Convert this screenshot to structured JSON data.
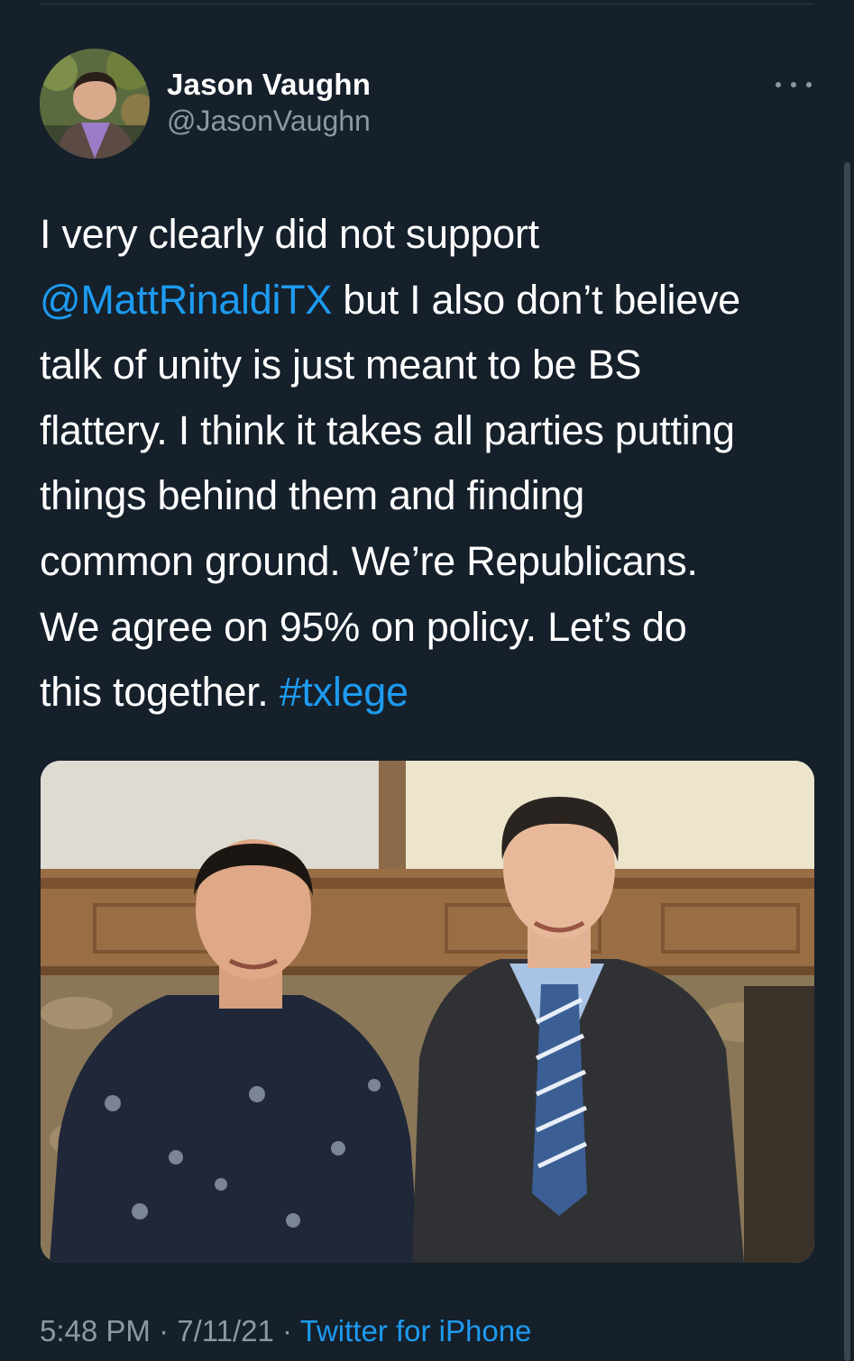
{
  "author": {
    "display_name": "Jason Vaughn",
    "handle": "@JasonVaughn"
  },
  "tweet": {
    "lines": [
      [
        {
          "text": "I very clearly did not support",
          "type": "text"
        }
      ],
      [
        {
          "text": "@MattRinaldiTX",
          "type": "mention"
        },
        {
          "text": " but I also don’t believe",
          "type": "text"
        }
      ],
      [
        {
          "text": "talk of unity is just meant to be BS",
          "type": "text"
        }
      ],
      [
        {
          "text": "flattery. I think it takes all parties putting",
          "type": "text"
        }
      ],
      [
        {
          "text": "things behind them and finding",
          "type": "text"
        }
      ],
      [
        {
          "text": "common ground. We’re Republicans.",
          "type": "text"
        }
      ],
      [
        {
          "text": "We agree on 95% on policy. Let’s do",
          "type": "text"
        }
      ],
      [
        {
          "text": "this together. ",
          "type": "text"
        },
        {
          "text": "#txlege",
          "type": "hashtag"
        }
      ]
    ]
  },
  "footer": {
    "time": "5:48 PM",
    "separator_1": " · ",
    "date": "7/11/21",
    "separator_2": " · ",
    "source": "Twitter for iPhone"
  },
  "icons": {
    "more": "more-horizontal-icon"
  },
  "colors": {
    "background": "#15202b",
    "link": "#1d9bf0",
    "secondary_text": "#8b98a5",
    "primary_text": "#ffffff"
  }
}
